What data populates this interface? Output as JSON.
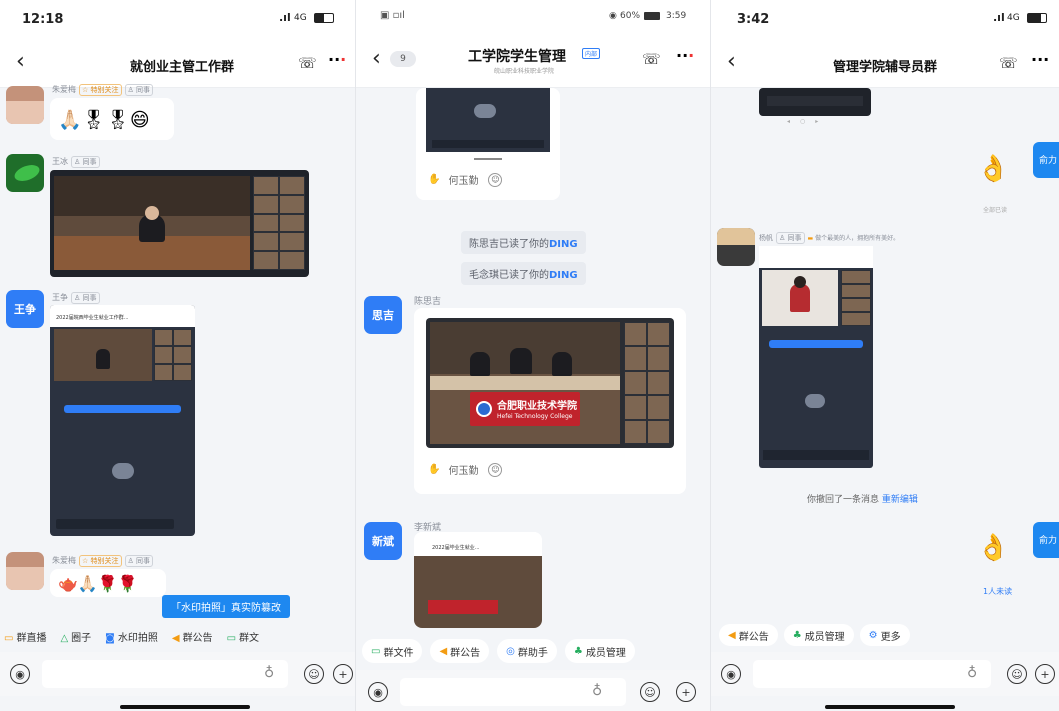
{
  "left": {
    "status": {
      "time": "12:18",
      "signal": "4G"
    },
    "nav": {
      "title": "就创业主管工作群"
    },
    "messages": [
      {
        "sender": "朱爱梅",
        "tag1": "特别关注",
        "tag2": "同事",
        "emoji": "🙏🏻🎖🎖😄"
      },
      {
        "sender": "王冰",
        "tag2": "同事"
      },
      {
        "sender": "王争",
        "tag2": "同事",
        "avatar_text": "王争",
        "inner_title": "2022届皖西毕业生就业工作群..."
      },
      {
        "sender": "朱爱梅",
        "tag1": "特别关注",
        "tag2": "同事",
        "emoji": "🫖🙏🏻🌹🌹"
      }
    ],
    "tooltip": "「水印拍照」真实防篡改",
    "toolbar": [
      "群直播",
      "圈子",
      "水印拍照",
      "群公告",
      "群文"
    ]
  },
  "middle": {
    "status": {
      "battery": "60%",
      "time": "3:59"
    },
    "nav": {
      "badge_count": "9",
      "title": "工学院学生管理",
      "title_tag": "内部",
      "subtitle": "皖山职业科技职业学院"
    },
    "reactions": [
      {
        "name": "何玉勤"
      },
      {
        "name": "何玉勤"
      }
    ],
    "read_notices": [
      {
        "text": "陈思吉已读了你的",
        "highlight": "DING"
      },
      {
        "text": "毛念琪已读了你的",
        "highlight": "DING"
      }
    ],
    "messages": [
      {
        "sender": "陈思吉",
        "avatar_text": "思吉",
        "banner_cn": "合肥职业技术学院",
        "banner_en": "Hefei Technology College"
      },
      {
        "sender": "李新斌",
        "avatar_text": "新斌",
        "inner_title": "2022届毕业生就业..."
      }
    ],
    "toolbar": [
      "群文件",
      "群公告",
      "群助手",
      "成员管理"
    ]
  },
  "right": {
    "status": {
      "time": "3:42",
      "signal": "4G"
    },
    "nav": {
      "title": "管理学院辅导员群"
    },
    "first_bubble": "俞力",
    "second_bubble": "俞力",
    "read_all": "全部已读",
    "message": {
      "sender": "杨帆",
      "tag2": "同事",
      "note": "做个最美的人，拥抱所有美好。"
    },
    "recall": {
      "text": "你撤回了一条消息",
      "action": "重新编辑"
    },
    "unread": "1人未读",
    "toolbar": [
      "群公告",
      "成员管理",
      "更多"
    ]
  }
}
